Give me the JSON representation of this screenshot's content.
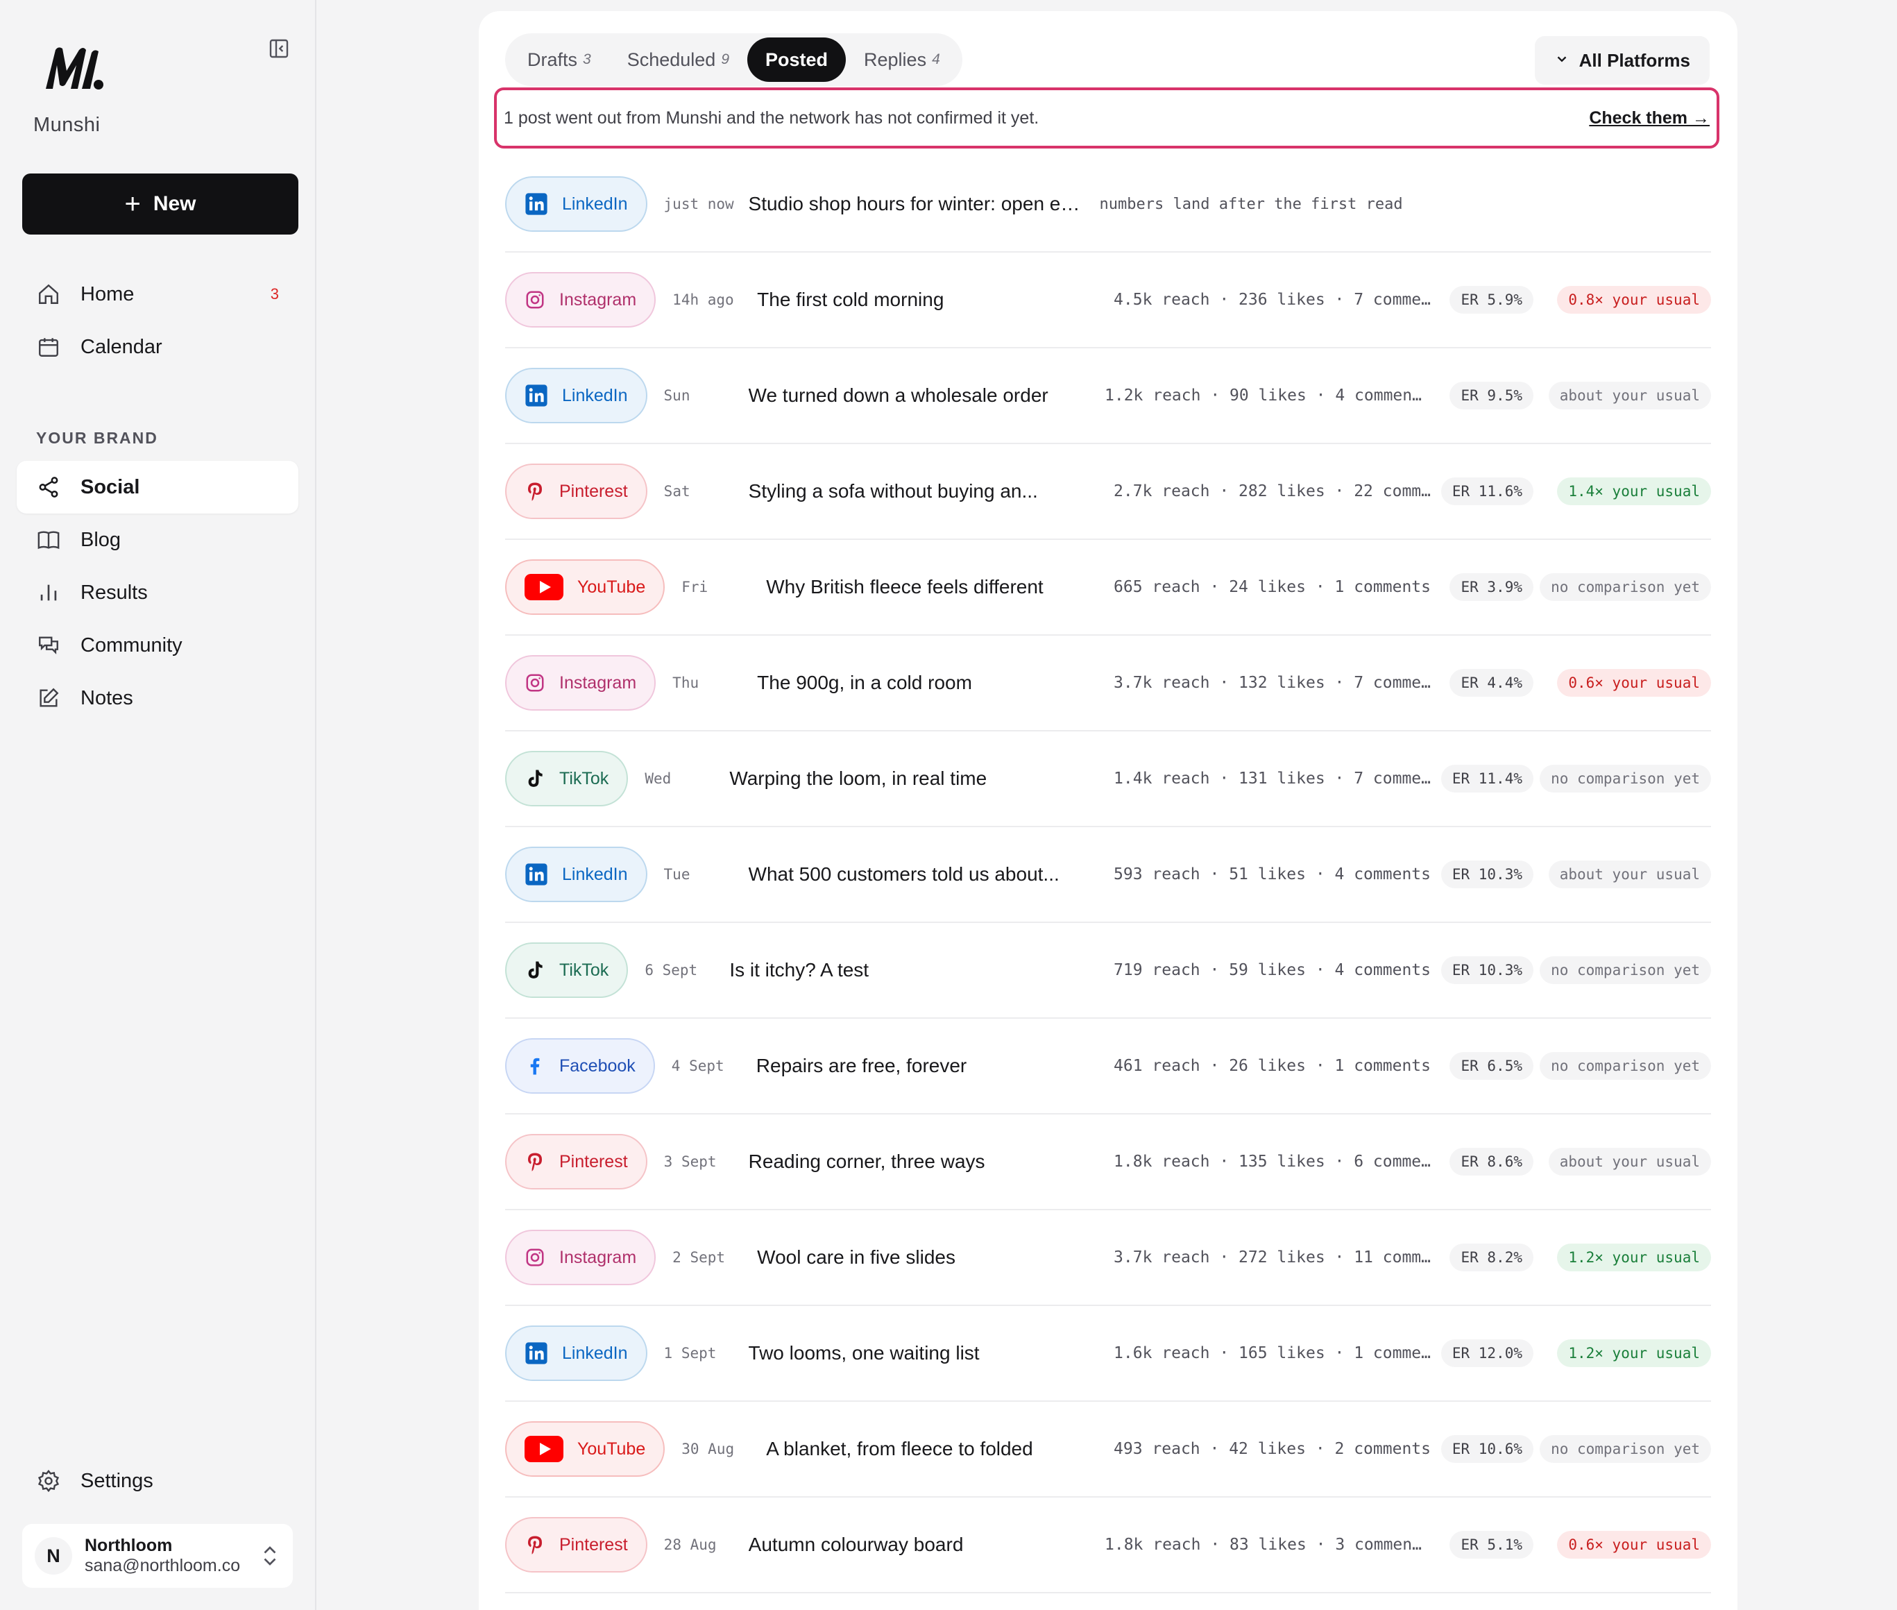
{
  "app": {
    "brand": "Munshi",
    "new_label": "New"
  },
  "sidebar": {
    "top_items": [
      {
        "label": "Home",
        "badge": "3",
        "icon": "home-icon"
      },
      {
        "label": "Calendar",
        "icon": "calendar-icon"
      }
    ],
    "section_label": "YOUR BRAND",
    "brand_items": [
      {
        "label": "Social",
        "icon": "share-icon",
        "active": true
      },
      {
        "label": "Blog",
        "icon": "book-icon"
      },
      {
        "label": "Results",
        "icon": "bar-chart-icon"
      },
      {
        "label": "Community",
        "icon": "chat-icon"
      },
      {
        "label": "Notes",
        "icon": "edit-icon"
      }
    ],
    "settings_label": "Settings",
    "account": {
      "initial": "N",
      "name": "Northloom",
      "email": "sana@northloom.co"
    }
  },
  "tabs": [
    {
      "label": "Drafts",
      "count": "3"
    },
    {
      "label": "Scheduled",
      "count": "9"
    },
    {
      "label": "Posted",
      "count": "",
      "active": true
    },
    {
      "label": "Replies",
      "count": "4"
    }
  ],
  "platform_filter": "All Platforms",
  "alert": {
    "text": "1 post went out from Munshi and the network has not confirmed it yet.",
    "link": "Check them →"
  },
  "colors": {
    "accent_border": "#d8336a",
    "primary": "#111113"
  },
  "posts": [
    {
      "platform": "LinkedIn",
      "time": "just now",
      "title": "Studio shop hours for winter: open every Satur...",
      "note": "numbers land after the first read"
    },
    {
      "platform": "Instagram",
      "time": "14h ago",
      "title": "The first cold morning",
      "stats": "4.5k reach · 236 likes · 7 comme…",
      "er": "ER 5.9%",
      "cmp": "0.8× your usual",
      "tone": "bad"
    },
    {
      "platform": "LinkedIn",
      "time": "Sun",
      "title": "We turned down a wholesale order",
      "stats": "1.2k reach · 90 likes · 4 comments",
      "er": "ER 9.5%",
      "cmp": "about your usual",
      "tone": "neutral"
    },
    {
      "platform": "Pinterest",
      "time": "Sat",
      "title": "Styling a sofa without buying an...",
      "stats": "2.7k reach · 282 likes · 22 comm…",
      "er": "ER 11.6%",
      "cmp": "1.4× your usual",
      "tone": "good"
    },
    {
      "platform": "YouTube",
      "time": "Fri",
      "title": "Why British fleece feels different",
      "stats": "665 reach · 24 likes · 1 comments",
      "er": "ER 3.9%",
      "cmp": "no comparison yet",
      "tone": "neutral"
    },
    {
      "platform": "Instagram",
      "time": "Thu",
      "title": "The 900g, in a cold room",
      "stats": "3.7k reach · 132 likes · 7 comme…",
      "er": "ER 4.4%",
      "cmp": "0.6× your usual",
      "tone": "bad"
    },
    {
      "platform": "TikTok",
      "time": "Wed",
      "title": "Warping the loom, in real time",
      "stats": "1.4k reach · 131 likes · 7 comme…",
      "er": "ER 11.4%",
      "cmp": "no comparison yet",
      "tone": "neutral"
    },
    {
      "platform": "LinkedIn",
      "time": "Tue",
      "title": "What 500 customers told us about...",
      "stats": "593 reach · 51 likes · 4 comments",
      "er": "ER 10.3%",
      "cmp": "about your usual",
      "tone": "neutral"
    },
    {
      "platform": "TikTok",
      "time": "6 Sept",
      "title": "Is it itchy? A test",
      "stats": "719 reach · 59 likes · 4 comments",
      "er": "ER 10.3%",
      "cmp": "no comparison yet",
      "tone": "neutral"
    },
    {
      "platform": "Facebook",
      "time": "4 Sept",
      "title": "Repairs are free, forever",
      "stats": "461 reach · 26 likes · 1 comments",
      "er": "ER 6.5%",
      "cmp": "no comparison yet",
      "tone": "neutral"
    },
    {
      "platform": "Pinterest",
      "time": "3 Sept",
      "title": "Reading corner, three ways",
      "stats": "1.8k reach · 135 likes · 6 comme…",
      "er": "ER 8.6%",
      "cmp": "about your usual",
      "tone": "neutral"
    },
    {
      "platform": "Instagram",
      "time": "2 Sept",
      "title": "Wool care in five slides",
      "stats": "3.7k reach · 272 likes · 11 comm…",
      "er": "ER 8.2%",
      "cmp": "1.2× your usual",
      "tone": "good"
    },
    {
      "platform": "LinkedIn",
      "time": "1 Sept",
      "title": "Two looms, one waiting list",
      "stats": "1.6k reach · 165 likes · 1 comme…",
      "er": "ER 12.0%",
      "cmp": "1.2× your usual",
      "tone": "good"
    },
    {
      "platform": "YouTube",
      "time": "30 Aug",
      "title": "A blanket, from fleece to folded",
      "stats": "493 reach · 42 likes · 2 comments",
      "er": "ER 10.6%",
      "cmp": "no comparison yet",
      "tone": "neutral"
    },
    {
      "platform": "Pinterest",
      "time": "28 Aug",
      "title": "Autumn colourway board",
      "stats": "1.8k reach · 83 likes · 3 comments",
      "er": "ER 5.1%",
      "cmp": "0.6× your usual",
      "tone": "bad"
    }
  ]
}
